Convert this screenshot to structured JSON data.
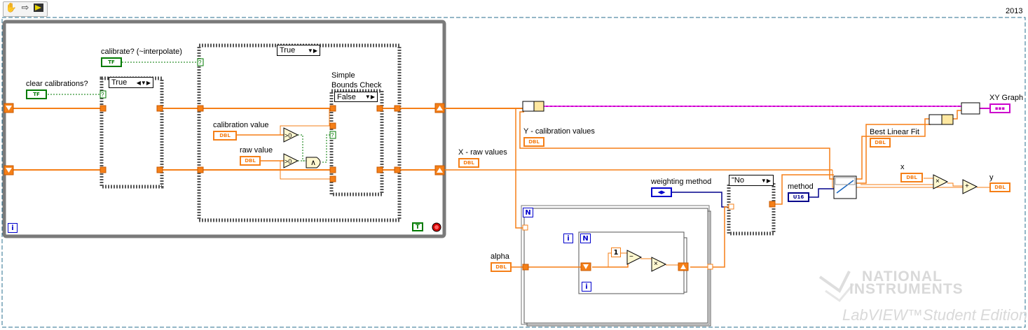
{
  "toolbar": {
    "year": "2013",
    "hand_icon": "hand-tool-icon",
    "arrow_icon": "arrow-tool-icon",
    "run_icon": "run-arrow-icon"
  },
  "labels": {
    "calibrate": "calibrate? (~interpolate)",
    "clear_calibrations": "clear calibrations?",
    "calibration_value": "calibration value",
    "raw_value": "raw value",
    "simple_bounds_1": "Simple",
    "simple_bounds_2": "Bounds Check",
    "x_raw_values": "X - raw values",
    "y_calibration_values": "Y - calibration values",
    "weighting_method": "weighting method",
    "method": "method",
    "alpha": "alpha",
    "best_linear_fit": "Best Linear Fit",
    "xy_graph": "XY Graph",
    "x": "x",
    "y": "y"
  },
  "selectors": {
    "case1": "True",
    "case_outer": "True",
    "case_bounds": "False",
    "weighting_case": "\"No"
  },
  "terminals": {
    "tf": "TF",
    "dbl": "DBL",
    "u16": "U16",
    "i": "i",
    "n": "N",
    "one": "1",
    "t": "T",
    "gt0": ">0",
    "and": "∧",
    "minus": "−",
    "times": "×",
    "plus": "+",
    "q": "?"
  },
  "watermark": {
    "line1": "NATIONAL",
    "line2": "INSTRUMENTS",
    "line3": "LabVIEW™Student Edition"
  },
  "colors": {
    "orange": "#f57f17",
    "pink": "#cc00cc",
    "green": "#007a00",
    "blue": "#0000cc",
    "grey_frame": "#7a7a7a"
  }
}
